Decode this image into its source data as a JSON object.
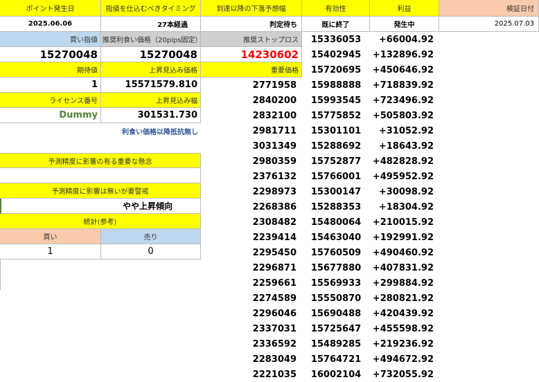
{
  "header": {
    "point_date_label": "ポイント発生日",
    "timing_label": "指値を仕込むべきタイミング",
    "forecast_label": "到達以降の下落予想幅",
    "validity_label": "有効性",
    "profit_label": "利益",
    "verify_date_label": "検証日付"
  },
  "row2": {
    "point_date": "2025.06.06",
    "timing": "27本経過",
    "forecast": "判定待ち",
    "validity": "既に終了",
    "profit": "発生中",
    "verify_date": "2025.07.03"
  },
  "left": {
    "buy_limit_label": "買い指値",
    "take_profit_label": "推奨利食い価格（20pips固定）",
    "stop_loss_label": "推奨ストップロス",
    "buy_limit": "15270048",
    "take_profit": "15270048",
    "stop_loss": "14230602",
    "expectation_label": "期待値",
    "rise_label": "上昇見込み価格",
    "important_label": "重要価格",
    "expectation": "1",
    "rise_price": "15571579.810",
    "license_label": "ライセンス番号",
    "rise_width_label": "上昇見込み幅",
    "license": "Dummy",
    "rise_width": "301531.730",
    "note": "利食い価格以降抵抗無し",
    "concern_label": "予測精度に影響の有る重要な懸念",
    "concern_value": "",
    "caution_label": "予測精度に影響は無いが要警戒",
    "caution_value": "やや上昇傾向",
    "stats_label": "統計(参考)",
    "buy_label": "買い",
    "sell_label": "売り",
    "buy_count": "1",
    "sell_count": "0"
  },
  "important_prices": [
    "2771958",
    "2840200",
    "2832100",
    "2981711",
    "3031349",
    "2980359",
    "2376132",
    "2298973",
    "2268386",
    "2308482",
    "2239414",
    "2295450",
    "2296871",
    "2259661",
    "2274589",
    "2296046",
    "2337031",
    "2336592",
    "2283049",
    "2221035"
  ],
  "validity_prices": [
    "15336053",
    "15402945",
    "15720695",
    "15988888",
    "15993545",
    "15775852",
    "15301101",
    "15288692",
    "15752877",
    "15766001",
    "15300147",
    "15288353",
    "15480064",
    "15463040",
    "15760509",
    "15677880",
    "15569933",
    "15550870",
    "15690488",
    "15725647",
    "15489285",
    "15764721",
    "16002104"
  ],
  "profits": [
    "+66004.92",
    "+132896.92",
    "+450646.92",
    "+718839.92",
    "+723496.92",
    "+505803.92",
    "+31052.92",
    "+18643.92",
    "+482828.92",
    "+495952.92",
    "+30098.92",
    "+18304.92",
    "+210015.92",
    "+192991.92",
    "+490460.92",
    "+407831.92",
    "+299884.92",
    "+280821.92",
    "+420439.92",
    "+455598.92",
    "+219236.92",
    "+494672.92",
    "+732055.92"
  ]
}
